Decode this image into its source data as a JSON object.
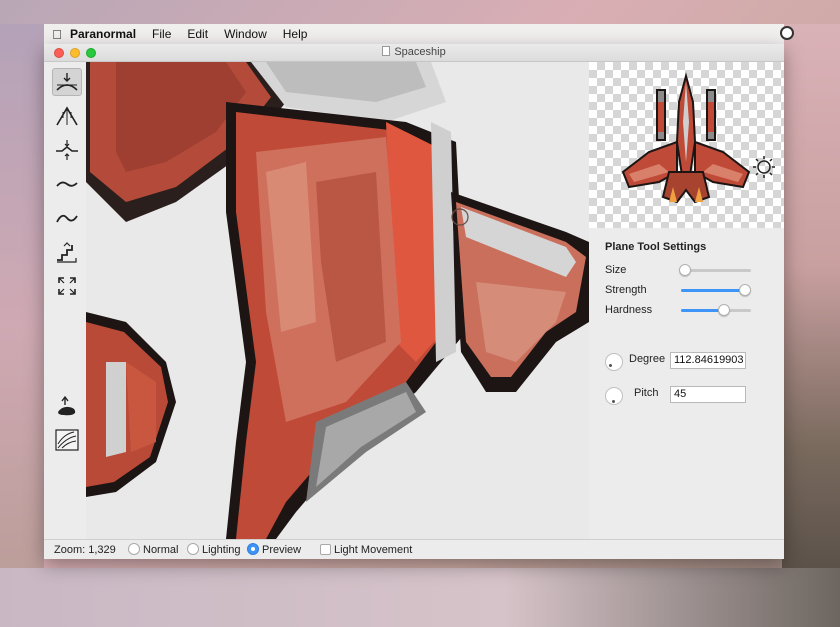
{
  "menubar": {
    "app_name": "Paranormal",
    "items": [
      "File",
      "Edit",
      "Window",
      "Help"
    ]
  },
  "window": {
    "title": "Spaceship"
  },
  "toolbar": {
    "tools": [
      {
        "icon": "plane-tool-icon",
        "active": true
      },
      {
        "icon": "pyramid-tool-icon",
        "active": false
      },
      {
        "icon": "emboss-tool-icon",
        "active": false
      },
      {
        "icon": "smooth-tool-icon",
        "active": false
      },
      {
        "icon": "wave-tool-icon",
        "active": false
      },
      {
        "icon": "stairs-tool-icon",
        "active": false
      },
      {
        "icon": "expand-tool-icon",
        "active": false
      },
      {
        "icon": "flood-fill-icon",
        "active": false
      },
      {
        "icon": "texture-tool-icon",
        "active": false
      }
    ]
  },
  "settings": {
    "title": "Plane Tool Settings",
    "size_label": "Size",
    "size_value": 0.05,
    "strength_label": "Strength",
    "strength_value": 0.92,
    "hardness_label": "Hardness",
    "hardness_value": 0.62,
    "degree_label": "Degree",
    "degree_value": "112.84619903",
    "pitch_label": "Pitch",
    "pitch_value": "45"
  },
  "statusbar": {
    "zoom": "Zoom: 1,329",
    "mode_normal": "Normal",
    "mode_lighting": "Lighting",
    "mode_preview": "Preview",
    "selected_mode": "Preview",
    "light_movement": "Light Movement",
    "light_movement_checked": false
  },
  "colors": {
    "accent": "#3e94f7",
    "ship_red": "#c74a37",
    "ship_light": "#d9806b"
  }
}
